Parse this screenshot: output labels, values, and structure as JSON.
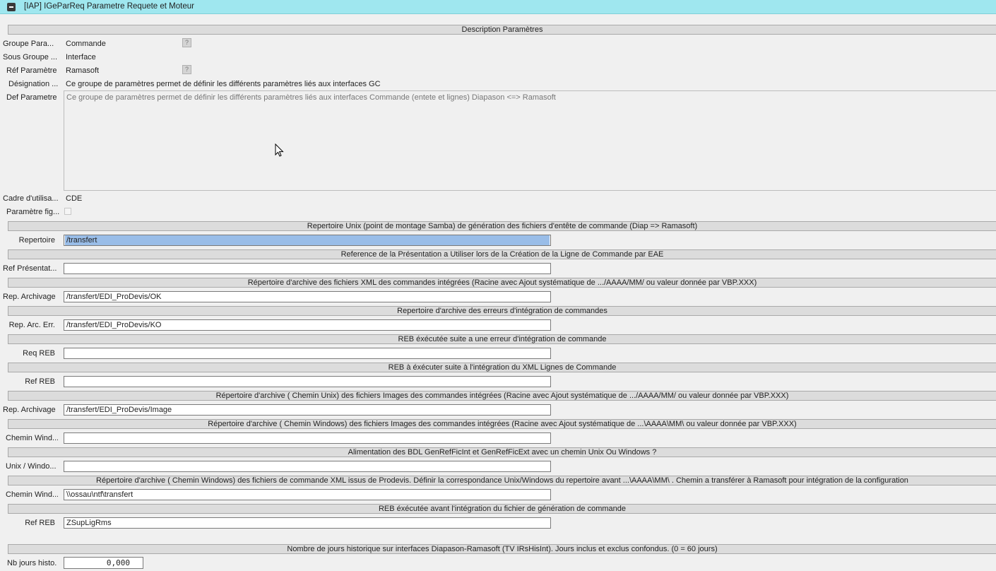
{
  "window": {
    "title": "[IAP] IGeParReq Parametre Requete et Moteur",
    "system_icon": "window-menu-icon"
  },
  "description": {
    "header": "Description Paramètres",
    "groupe_label": "Groupe Para...",
    "groupe_value": "Commande",
    "sous_groupe_label": "Sous Groupe ...",
    "sous_groupe_value": "Interface",
    "ref_label": "Réf Paramètre",
    "ref_value": "Ramasoft",
    "designation_label": "Désignation ...",
    "designation_value": "Ce groupe de paramètres permet de définir les différents paramètres liés aux interfaces GC",
    "def_label": "Def Parametre",
    "def_value": "Ce groupe de paramètres permet de définir les différents paramètres liés aux interfaces Commande (entete et lignes) Diapason <=> Ramasoft",
    "cadre_label": "Cadre d'utilisa...",
    "cadre_value": "CDE",
    "fige_label": "Paramètre fig...",
    "fige_checked": false,
    "lookup_glyph": "?"
  },
  "sections": [
    {
      "header": "Repertoire Unix (point de montage Samba) de génération des fichiers d'entête de commande (Diap => Ramasoft)",
      "label": "Repertoire",
      "value": "/transfert"
    },
    {
      "header": "Reference de la Présentation a Utiliser lors de la Création de la Ligne de Commande par EAE",
      "label": "Ref Présentat...",
      "value": ""
    },
    {
      "header": "Répertoire d'archive des fichiers XML des commandes intégrées  (Racine avec Ajout systématique de  .../AAAA/MM/  ou valeur donnée par VBP.XXX)",
      "label": "Rep. Archivage",
      "value": "/transfert/EDI_ProDevis/OK"
    },
    {
      "header": "Repertoire d'archive des erreurs d'intégration de commandes",
      "label": "Rep. Arc. Err.",
      "value": "/transfert/EDI_ProDevis/KO"
    },
    {
      "header": "REB éxécutée suite a une erreur d'intégration de commande",
      "label": "Req REB",
      "value": ""
    },
    {
      "header": "REB à éxécuter suite à l'intégration du XML Lignes de Commande",
      "label": "Ref REB",
      "value": ""
    },
    {
      "header": "Répertoire d'archive ( Chemin Unix) des fichiers Images des commandes intégrées  (Racine avec Ajout systématique de  .../AAAA/MM/  ou valeur donnée par VBP.XXX)",
      "label": "Rep. Archivage",
      "value": "/transfert/EDI_ProDevis/Image"
    },
    {
      "header": "Répertoire d'archive ( Chemin Windows) des fichiers Images des commandes intégrées  (Racine avec Ajout systématique de  ...\\AAAA\\MM\\  ou valeur donnée par VBP.XXX)",
      "label": "Chemin Wind...",
      "value": ""
    },
    {
      "header": "Alimentation des BDL GenRefFicInt et GenRefFicExt avec un chemin Unix Ou Windows ?",
      "label": "Unix / Windo...",
      "value": ""
    },
    {
      "header": "Répertoire d'archive ( Chemin Windows) des fichiers de commande  XML issus de Prodevis. Définir la correspondance Unix/Windows du repertoire avant   ...\\AAAA\\MM\\  .  Chemin a transférer à Ramasoft pour intégration de la configuration",
      "label": "Chemin Wind...",
      "value": "\\\\ossau\\ntf\\transfert"
    },
    {
      "header": "REB éxécutée avant l'intégration du fichier de génération de commande",
      "label": "Ref REB",
      "value": "ZSupLigRms"
    }
  ],
  "historique": {
    "header": "Nombre de jours historique sur interfaces Diapason-Ramasoft (TV IRsHisInt). Jours inclus et exclus confondus. (0 = 60 jours)",
    "label": "Nb jours histo.",
    "value": "0,000"
  }
}
